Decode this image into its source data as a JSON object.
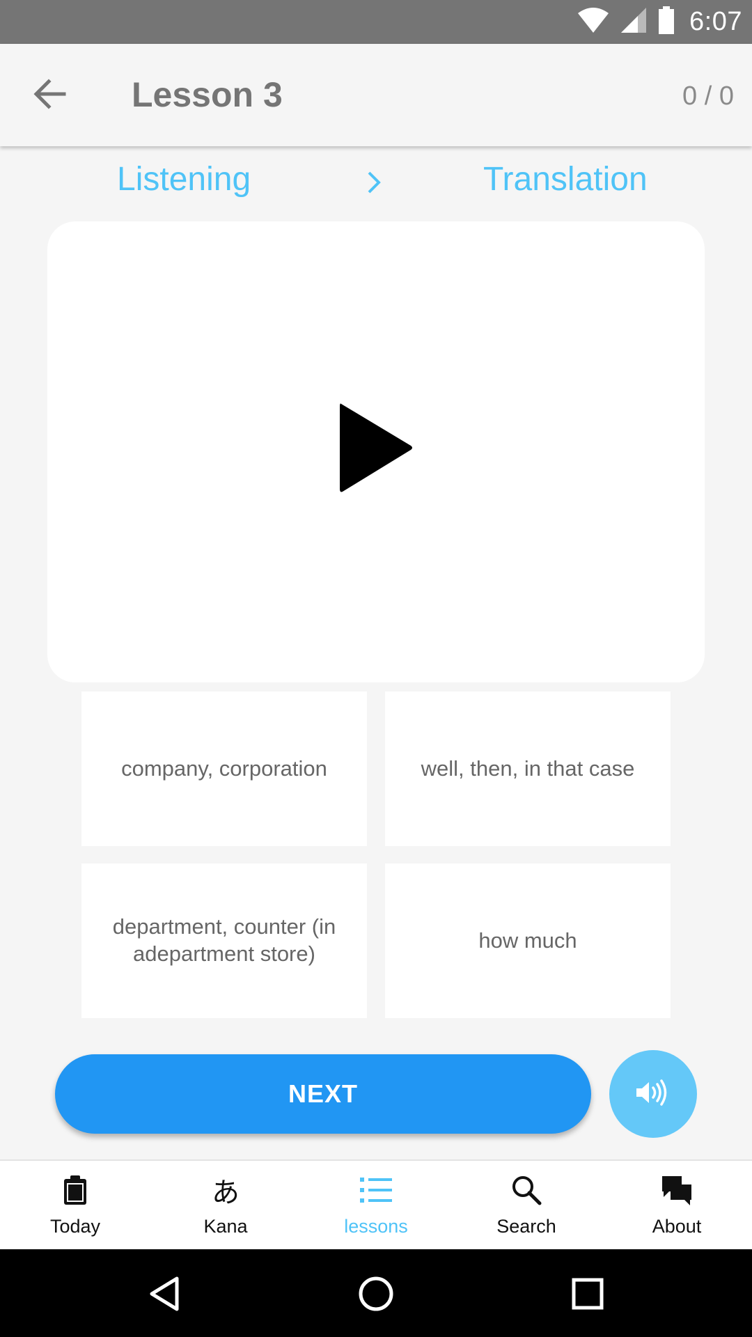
{
  "status_bar": {
    "time": "6:07"
  },
  "app_bar": {
    "title": "Lesson 3",
    "progress": "0 / 0"
  },
  "modes": {
    "listening": "Listening",
    "translation": "Translation"
  },
  "options": [
    {
      "text": "company, corporation"
    },
    {
      "text": "well, then, in that case"
    },
    {
      "text": "department, counter (in adepartment store)"
    },
    {
      "text": "how much"
    }
  ],
  "next_button": {
    "label": "NEXT"
  },
  "bottom_nav": {
    "active": "lessons",
    "items": [
      {
        "label": "Today",
        "icon": "clipboard-icon"
      },
      {
        "label": "Kana",
        "icon": "hiragana-a-icon",
        "glyph": "あ"
      },
      {
        "label": "lessons",
        "icon": "list-icon"
      },
      {
        "label": "Search",
        "icon": "search-icon"
      },
      {
        "label": "About",
        "icon": "chat-bubbles-icon"
      }
    ]
  },
  "colors": {
    "accent_light": "#4fc3f7",
    "primary": "#2196f3",
    "audio_button": "#64c8f8",
    "status_bar": "#757575"
  }
}
